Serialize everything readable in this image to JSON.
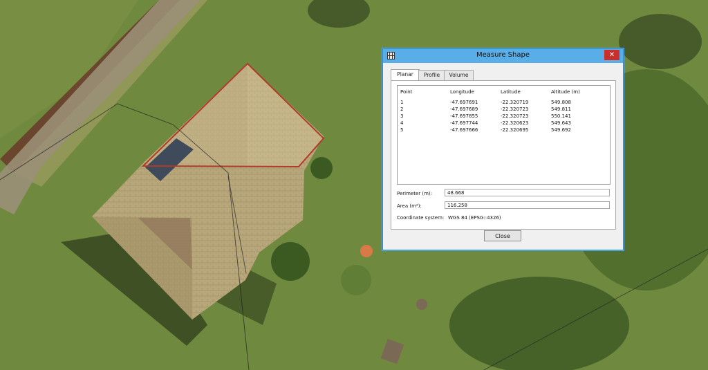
{
  "window": {
    "title": "Measure Shape",
    "close_glyph": "✕"
  },
  "tabs": [
    {
      "label": "Planar",
      "active": true
    },
    {
      "label": "Profile",
      "active": false
    },
    {
      "label": "Volume",
      "active": false
    }
  ],
  "table": {
    "columns": [
      "Point",
      "Longitude",
      "Latitude",
      "Altitude (m)"
    ],
    "rows": [
      [
        "1",
        "-47.697691",
        "-22.320719",
        "549.808"
      ],
      [
        "2",
        "-47.697689",
        "-22.320723",
        "549.811"
      ],
      [
        "3",
        "-47.697855",
        "-22.320723",
        "550.141"
      ],
      [
        "4",
        "-47.697744",
        "-22.320623",
        "549.643"
      ],
      [
        "5",
        "-47.697666",
        "-22.320695",
        "549.692"
      ]
    ]
  },
  "perimeter": {
    "label": "Perimeter (m):",
    "value": "48.668"
  },
  "area": {
    "label": "Area (m²):",
    "value": "116.258"
  },
  "coordinate_system": {
    "label": "Coordinate system:",
    "value": "WGS 84 (EPSG::4326)"
  },
  "buttons": {
    "close": "Close"
  },
  "colors": {
    "accent": "#5aaee8",
    "close_red": "#c9302c",
    "measure_outline": "#b23a2a"
  }
}
